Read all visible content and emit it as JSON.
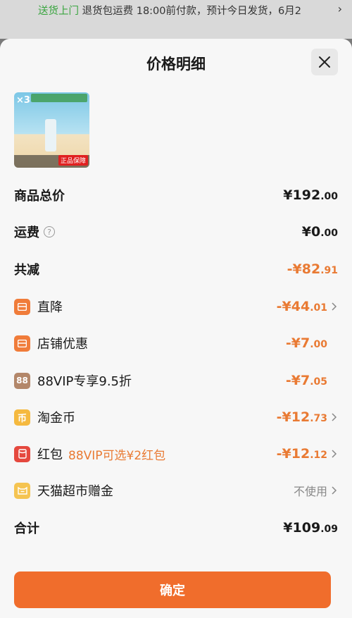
{
  "top_notice": {
    "highlight": "送货上门",
    "text": "退货包运费 18:00前付款，预计今日发货，6月2"
  },
  "sheet": {
    "title": "价格明细"
  },
  "product": {
    "quantity": "×3",
    "badge": "正品保障"
  },
  "rows": {
    "total": {
      "label": "商品总价",
      "amount": "¥192",
      "decimal": ".00"
    },
    "shipping": {
      "label": "运费",
      "help": "?",
      "amount": "¥0",
      "decimal": ".00"
    },
    "reduced": {
      "label": "共减",
      "amount": "-¥82",
      "decimal": ".91"
    },
    "direct": {
      "label": "直降",
      "amount": "-¥44",
      "decimal": ".01"
    },
    "store": {
      "label": "店铺优惠",
      "amount": "-¥7",
      "decimal": ".00"
    },
    "vip": {
      "label": "88VIP专享9.5折",
      "icon_text": "88",
      "amount": "-¥7",
      "decimal": ".05"
    },
    "coin": {
      "label": "淘金币",
      "icon_text": "币",
      "amount": "-¥12",
      "decimal": ".73"
    },
    "redpacket": {
      "label": "红包",
      "sub": "88VIP可选¥2红包",
      "amount": "-¥12",
      "decimal": ".12"
    },
    "gift": {
      "label": "天猫超市赠金",
      "value": "不使用"
    },
    "sum": {
      "label": "合计",
      "amount": "¥109",
      "decimal": ".09"
    }
  },
  "confirm_label": "确定",
  "colors": {
    "accent": "#f06d2c",
    "discount": "#e97a33",
    "icon_orange": "#f07c3a",
    "icon_yellow": "#f5b93f",
    "icon_red": "#e5483e",
    "icon_brown": "#b3876a",
    "green": "#3aa540"
  }
}
